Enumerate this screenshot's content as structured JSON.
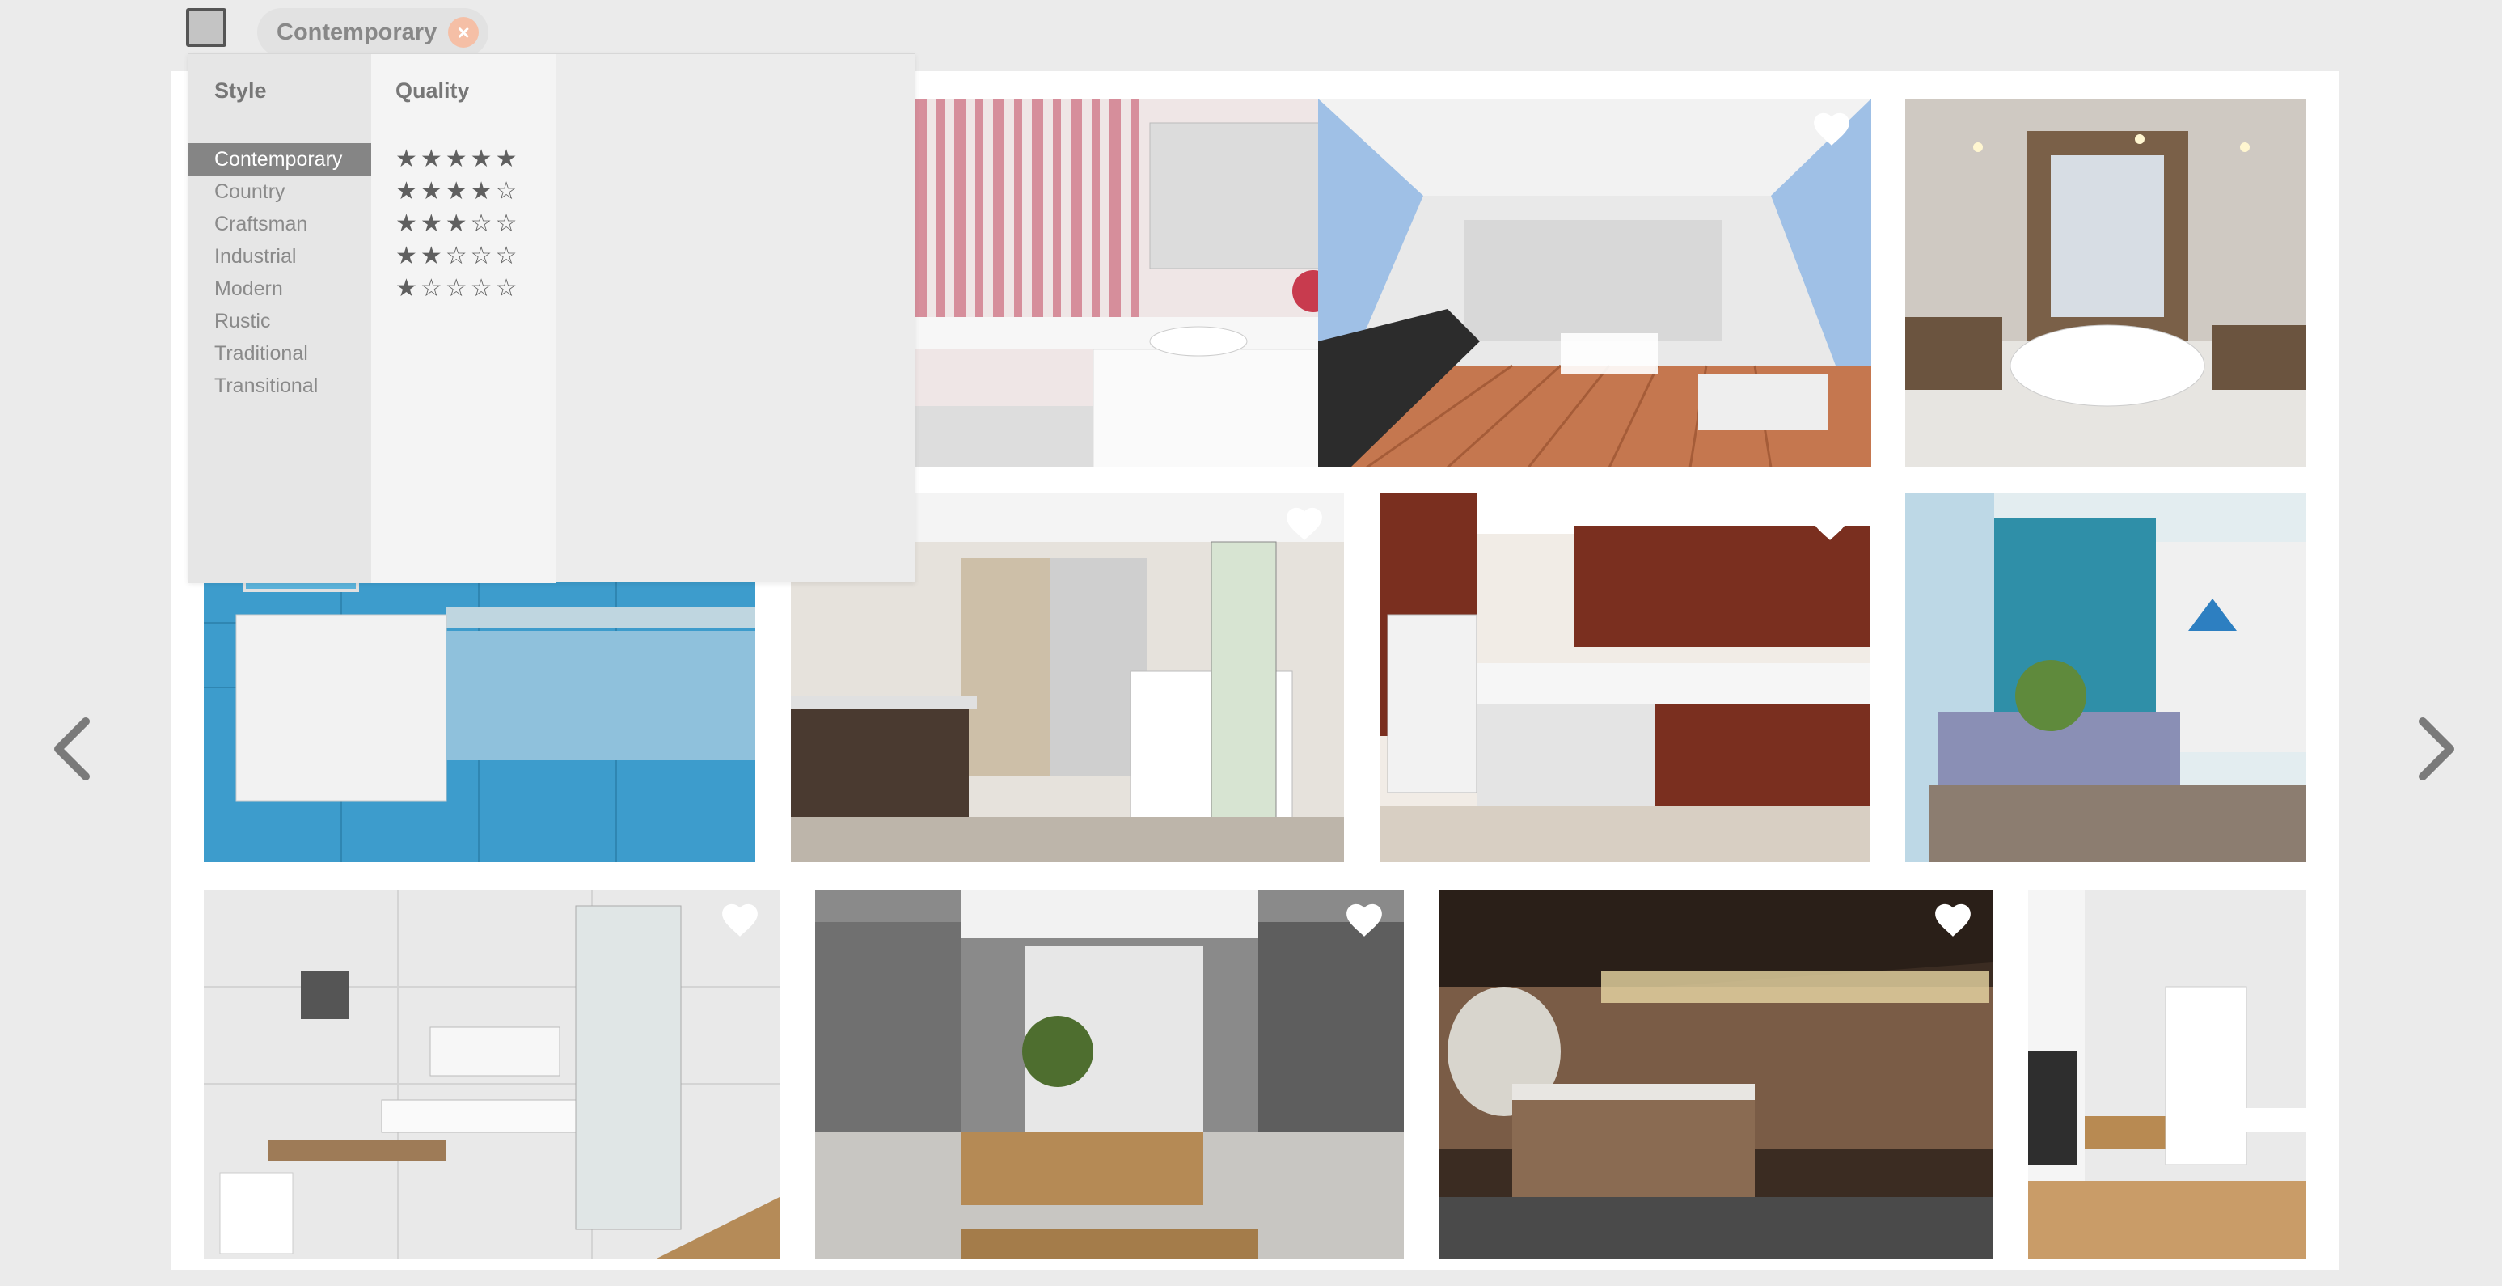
{
  "filter_bar": {
    "active_filter": "Contemporary",
    "remove_icon": "close-icon",
    "menu_icon": "menu-square-icon"
  },
  "filter_menu": {
    "style_header": "Style",
    "quality_header": "Quality",
    "styles": [
      {
        "label": "Contemporary",
        "selected": true
      },
      {
        "label": "Country",
        "selected": false
      },
      {
        "label": "Craftsman",
        "selected": false
      },
      {
        "label": "Industrial",
        "selected": false
      },
      {
        "label": "Modern",
        "selected": false
      },
      {
        "label": "Rustic",
        "selected": false
      },
      {
        "label": "Traditional",
        "selected": false
      },
      {
        "label": "Transitional",
        "selected": false
      }
    ],
    "quality": [
      {
        "stars": "★★★★★",
        "rating": 5
      },
      {
        "stars": "★★★★☆",
        "rating": 4
      },
      {
        "stars": "★★★☆☆",
        "rating": 3
      },
      {
        "stars": "★★☆☆☆",
        "rating": 2
      },
      {
        "stars": "★☆☆☆☆",
        "rating": 1
      }
    ]
  },
  "gallery": {
    "heart_icon": "heart-icon",
    "tiles": [
      {
        "subject": "pink mosaic tiled bathroom with vanity",
        "favorite_icon": true
      },
      {
        "subject": "covered wooden deck patio with dining set",
        "favorite_icon": true
      },
      {
        "subject": "bathroom with freestanding tub and candles",
        "favorite_icon": false
      },
      {
        "subject": "blue tiled bathroom with floating sink",
        "favorite_icon": false
      },
      {
        "subject": "bathroom with dark wood vanity and glass shower",
        "favorite_icon": true
      },
      {
        "subject": "kitchen with red-brown gloss cabinets",
        "favorite_icon": true
      },
      {
        "subject": "living room with blue wall and grey sofa",
        "favorite_icon": false
      },
      {
        "subject": "white marble bathroom with wall sink",
        "favorite_icon": true
      },
      {
        "subject": "grey bathroom with wood bathtub and plant",
        "favorite_icon": true
      },
      {
        "subject": "dark wood kitchen with marble island",
        "favorite_icon": true
      },
      {
        "subject": "white kitchen with dining chairs",
        "favorite_icon": false
      }
    ]
  },
  "nav": {
    "prev_icon": "chevron-left-icon",
    "next_icon": "chevron-right-icon"
  },
  "colors": {
    "selected_bg": "#858585",
    "chip_close": "#f5bfa6",
    "page_bg": "#ebebeb"
  }
}
